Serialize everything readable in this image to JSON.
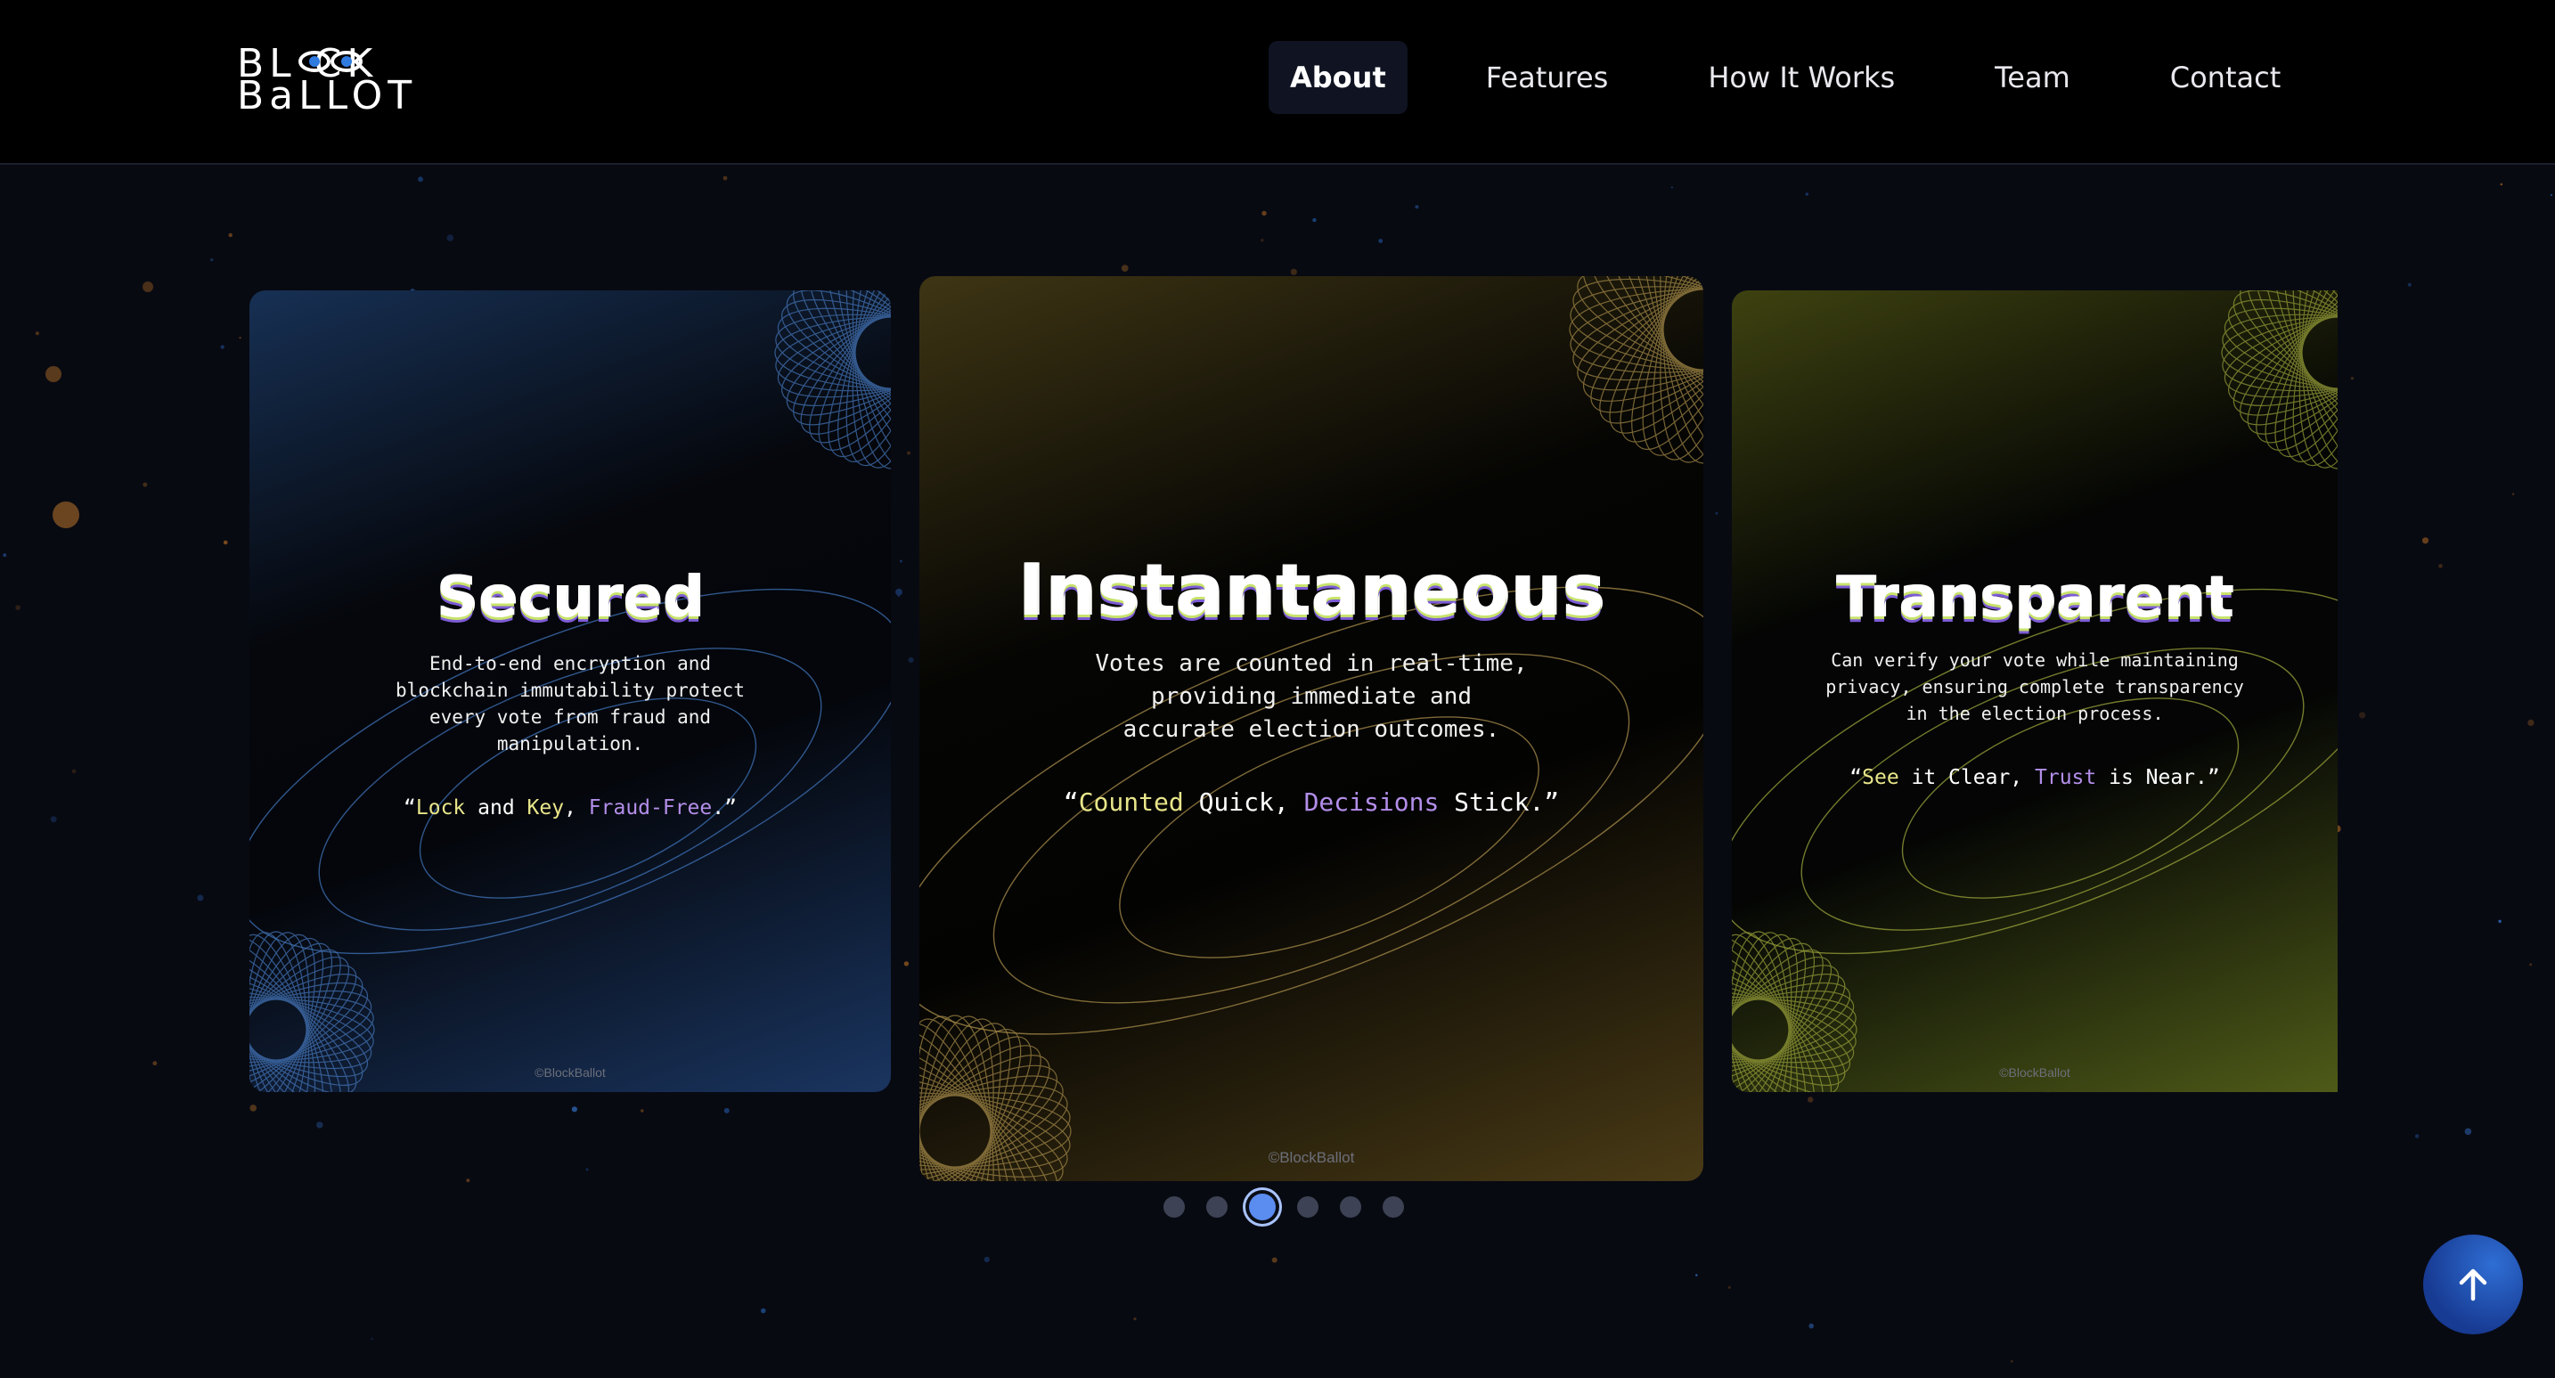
{
  "header": {
    "logo_line1": "BL  CK",
    "logo_line2": "BaLLOT",
    "nav": [
      {
        "label": "About",
        "active": true
      },
      {
        "label": "Features",
        "active": false
      },
      {
        "label": "How It Works",
        "active": false
      },
      {
        "label": "Team",
        "active": false
      },
      {
        "label": "Contact",
        "active": false
      }
    ]
  },
  "cards": [
    {
      "title": "Secured",
      "description": "End-to-end encryption and blockchain immutability protect every vote from fraud and manipulation.",
      "quote_open": "“",
      "quote_parts": [
        "Lock",
        " and ",
        "Key",
        ", ",
        "Fraud-Free",
        ".”"
      ],
      "footer": "©BlockBallot",
      "accent": "#3b6ab5"
    },
    {
      "title": "Instantaneous",
      "description": "Votes are counted in real-time, providing immediate and accurate election outcomes.",
      "quote_open": "“",
      "quote_parts": [
        "Counted",
        " Quick, ",
        "Decisions",
        " Stick.”"
      ],
      "footer": "©BlockBallot",
      "accent": "#b38a3a"
    },
    {
      "title": "Transparent",
      "description": "Can verify your vote while maintaining privacy, ensuring complete transparency in the election process.",
      "quote_open": "“",
      "quote_parts": [
        "See",
        " it Clear, ",
        "Trust",
        " is Near.”"
      ],
      "footer": "©BlockBallot",
      "accent": "#a4a838"
    }
  ],
  "carousel": {
    "dot_count": 6,
    "active_index": 2
  },
  "colors": {
    "background": "#080a12",
    "nav": "#000000",
    "active_dot": "#5b8cf0",
    "quote_yellow": "#e8e58a",
    "quote_purple": "#b38ee9"
  },
  "icons": {
    "scroll_top": "arrow-up-icon"
  }
}
